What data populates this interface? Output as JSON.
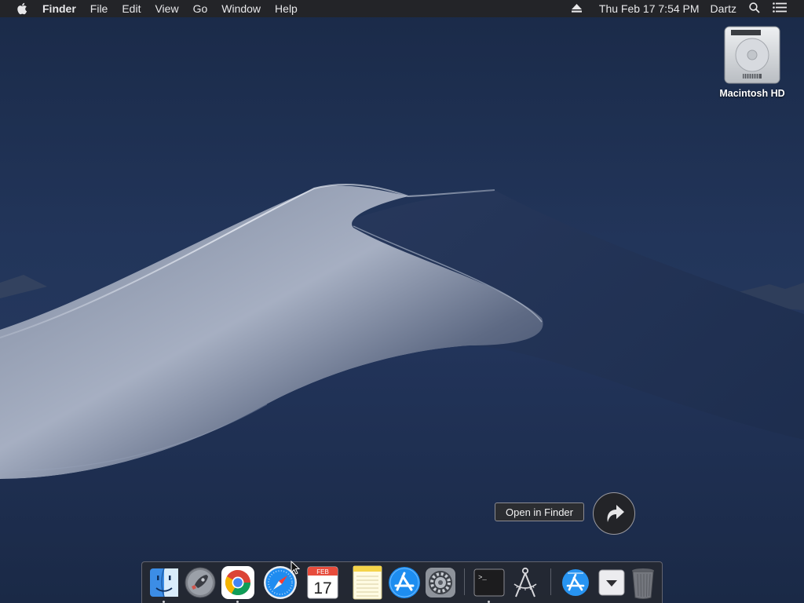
{
  "menubar": {
    "app_name": "Finder",
    "menus": [
      "File",
      "Edit",
      "View",
      "Go",
      "Window",
      "Help"
    ],
    "clock": "Thu Feb 17  7:54 PM",
    "user": "Dartz",
    "icons": [
      "apple-logo-icon",
      "eject-icon",
      "search-icon",
      "notification-center-icon"
    ]
  },
  "desktop": {
    "items": [
      {
        "label": "Macintosh HD",
        "icon": "hard-drive-icon"
      }
    ]
  },
  "tooltip": {
    "text": "Open in Finder"
  },
  "share_button": {
    "icon": "share-arrow-icon"
  },
  "dock": {
    "items": [
      {
        "name": "Finder",
        "icon": "finder-icon",
        "running": true
      },
      {
        "name": "Launchpad",
        "icon": "launchpad-rocket-icon",
        "running": false
      },
      {
        "name": "Google Chrome",
        "icon": "chrome-icon",
        "running": true
      },
      {
        "name": "Safari",
        "icon": "safari-icon",
        "running": false
      },
      {
        "name": "Calendar",
        "icon": "calendar-icon",
        "running": false,
        "month": "FEB",
        "day": "17"
      },
      {
        "name": "Notes",
        "icon": "notes-icon",
        "running": false
      },
      {
        "name": "App Store",
        "icon": "app-store-icon",
        "running": false
      },
      {
        "name": "System Preferences",
        "icon": "system-preferences-icon",
        "running": false
      },
      {
        "name": "Terminal",
        "icon": "terminal-icon",
        "running": true,
        "prompt": ">_"
      },
      {
        "name": "Xcode Instruments",
        "icon": "compass-tool-icon",
        "running": false
      },
      {
        "name": "Downloads",
        "icon": "app-store-folder-icon",
        "running": false
      },
      {
        "name": "Downloads Stack",
        "icon": "download-stack-icon",
        "running": false
      },
      {
        "name": "Trash",
        "icon": "trash-icon",
        "running": false
      }
    ]
  },
  "colors": {
    "menubar_bg": "#232428",
    "sky": "#1e3152",
    "dune_light": "#c8cfdd"
  }
}
